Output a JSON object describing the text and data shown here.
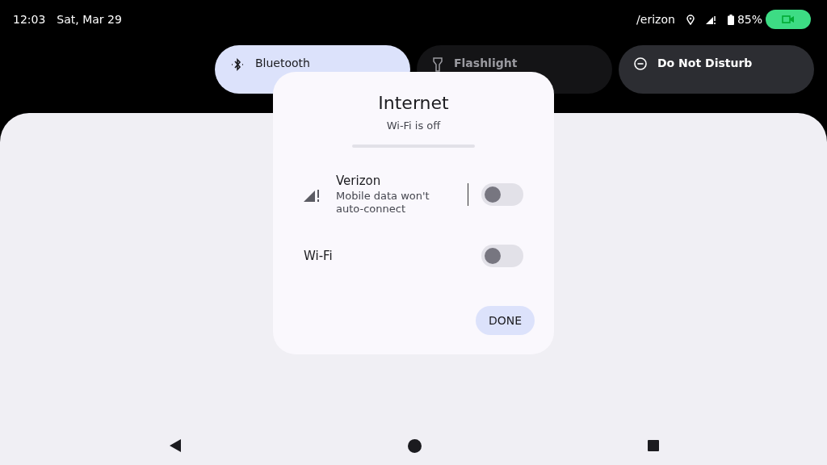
{
  "status_bar": {
    "time": "12:03",
    "date": "Sat, Mar 29",
    "carrier": "/erizon",
    "battery": "85%"
  },
  "tiles": [
    {
      "label": "Bluetooth",
      "on": true,
      "disabled": false
    },
    {
      "label": "Flashlight",
      "on": false,
      "disabled": true
    },
    {
      "label": "Do Not Disturb",
      "on": false,
      "disabled": false
    }
  ],
  "dialog": {
    "title": "Internet",
    "subtitle": "Wi-Fi is off",
    "rows": [
      {
        "kind": "network",
        "name": "Verizon",
        "summary": "Mobile data won't auto-connect",
        "checked": false
      },
      {
        "kind": "plain",
        "name": "Wi-Fi",
        "checked": false
      }
    ],
    "button": "DONE"
  }
}
